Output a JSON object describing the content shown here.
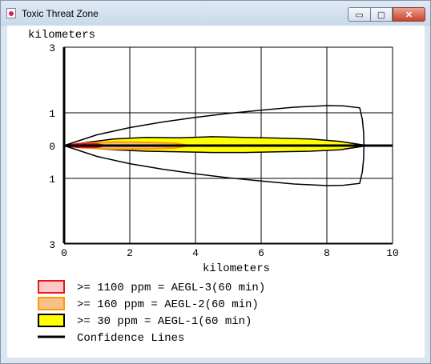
{
  "window": {
    "title": "Toxic Threat Zone",
    "controls": {
      "minimize": "▭",
      "maximize": "▢",
      "close": "✕"
    }
  },
  "chart_data": {
    "type": "area",
    "ylabel": "kilometers",
    "xlabel": "kilometers",
    "xlim": [
      0,
      10
    ],
    "ylim": [
      -3,
      3
    ],
    "x_ticks": [
      "0",
      "2",
      "4",
      "6",
      "8",
      "10"
    ],
    "y_ticks": [
      {
        "value": 3,
        "label": "3"
      },
      {
        "value": 1,
        "label": "1"
      },
      {
        "value": 0,
        "label": "0"
      },
      {
        "value": -1,
        "label": "1"
      },
      {
        "value": -3,
        "label": "3"
      }
    ],
    "grid": true,
    "series": [
      {
        "name": ">= 30 ppm = AEGL-1(60 min)",
        "fill": "#ffff00",
        "points": [
          [
            0,
            0
          ],
          [
            0.5,
            0.07
          ],
          [
            1.5,
            0.2
          ],
          [
            2.5,
            0.25
          ],
          [
            3.5,
            0.24
          ],
          [
            4.5,
            0.27
          ],
          [
            5.5,
            0.25
          ],
          [
            6.5,
            0.23
          ],
          [
            7.5,
            0.2
          ],
          [
            8.4,
            0.13
          ],
          [
            9.1,
            0.02
          ],
          [
            9.1,
            -0.02
          ],
          [
            8.4,
            -0.13
          ],
          [
            7.5,
            -0.17
          ],
          [
            6.5,
            -0.19
          ],
          [
            5.5,
            -0.21
          ],
          [
            4.5,
            -0.21
          ],
          [
            3.5,
            -0.19
          ],
          [
            2.5,
            -0.17
          ],
          [
            1.5,
            -0.13
          ],
          [
            0.5,
            -0.05
          ],
          [
            0,
            0
          ]
        ]
      },
      {
        "name": ">= 160 ppm = AEGL-2(60 min)",
        "fill": "#f5c08a",
        "points": [
          [
            0,
            0
          ],
          [
            0.5,
            0.06
          ],
          [
            1.5,
            0.11
          ],
          [
            2.5,
            0.1
          ],
          [
            3.4,
            0.07
          ],
          [
            3.8,
            0.0
          ],
          [
            3.4,
            -0.07
          ],
          [
            2.5,
            -0.1
          ],
          [
            1.5,
            -0.11
          ],
          [
            0.5,
            -0.06
          ],
          [
            0,
            0
          ]
        ]
      },
      {
        "name": ">= 1100 ppm = AEGL-3(60 min)",
        "fill": "#ffc8c8",
        "points": [
          [
            0,
            0
          ],
          [
            0.4,
            0.05
          ],
          [
            1.0,
            0.05
          ],
          [
            1.25,
            0.0
          ],
          [
            1.0,
            -0.05
          ],
          [
            0.4,
            -0.05
          ],
          [
            0,
            0
          ]
        ]
      }
    ],
    "confidence_lines": {
      "name": "Confidence Lines",
      "upper": [
        [
          0,
          0
        ],
        [
          1,
          0.33
        ],
        [
          2,
          0.55
        ],
        [
          3,
          0.72
        ],
        [
          4,
          0.86
        ],
        [
          5,
          0.98
        ],
        [
          6,
          1.08
        ],
        [
          7,
          1.17
        ],
        [
          8,
          1.22
        ],
        [
          8.5,
          1.21
        ],
        [
          9.0,
          1.15
        ],
        [
          9.08,
          0.8
        ],
        [
          9.12,
          0.4
        ],
        [
          9.13,
          0.0
        ]
      ],
      "lower": [
        [
          0,
          0
        ],
        [
          1,
          -0.33
        ],
        [
          2,
          -0.55
        ],
        [
          3,
          -0.72
        ],
        [
          4,
          -0.86
        ],
        [
          5,
          -0.98
        ],
        [
          6,
          -1.08
        ],
        [
          7,
          -1.17
        ],
        [
          8,
          -1.22
        ],
        [
          8.5,
          -1.21
        ],
        [
          9.0,
          -1.15
        ],
        [
          9.08,
          -0.8
        ],
        [
          9.12,
          -0.4
        ],
        [
          9.13,
          0.0
        ]
      ],
      "centerline_end": 10
    },
    "legend": {
      "placement": "bottom-left",
      "items": [
        {
          "label": ">= 1100 ppm = AEGL-3(60 min)",
          "fill": "#ffc8c8",
          "stroke": "#e8141c"
        },
        {
          "label": ">= 160 ppm = AEGL-2(60 min)",
          "fill": "#f5c08a",
          "stroke": "#ff9c00"
        },
        {
          "label": ">= 30 ppm = AEGL-1(60 min)",
          "fill": "#ffff00",
          "stroke": "#000000"
        },
        {
          "label": "Confidence Lines",
          "fill": "none",
          "stroke": "#000000"
        }
      ]
    }
  }
}
